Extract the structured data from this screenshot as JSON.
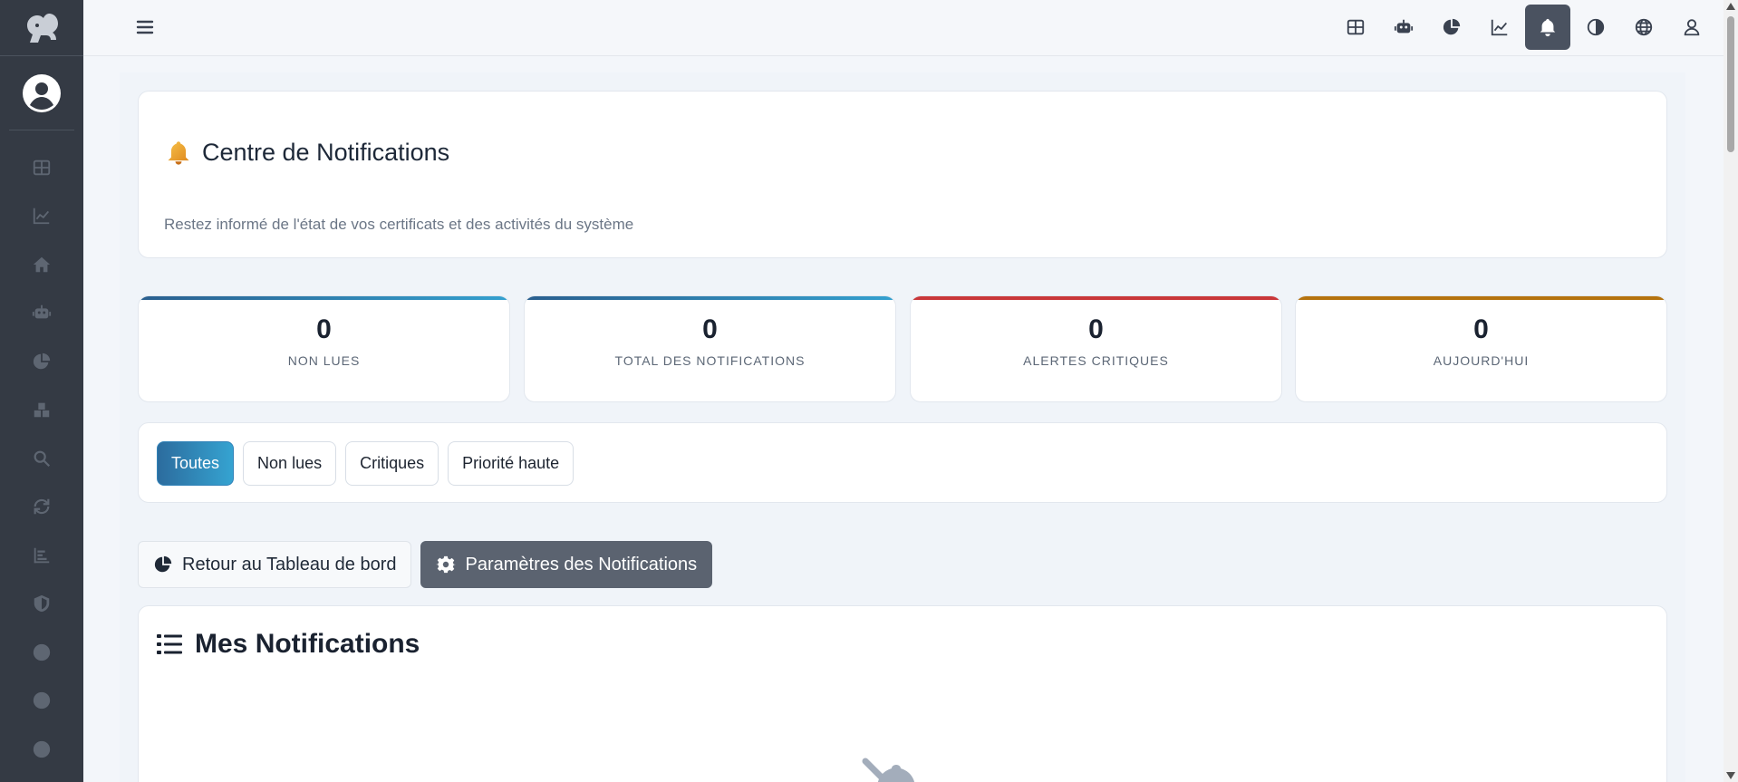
{
  "header": {
    "title": "Centre de Notifications",
    "subtitle": "Restez informé de l'état de vos certificats et des activités du système"
  },
  "stats": [
    {
      "value": "0",
      "label": "NON LUES",
      "color": "#2d75a8"
    },
    {
      "value": "0",
      "label": "TOTAL DES NOTIFICATIONS",
      "color": "#2d75a8"
    },
    {
      "value": "0",
      "label": "ALERTES CRITIQUES",
      "color": "#c9373a"
    },
    {
      "value": "0",
      "label": "AUJOURD'HUI",
      "color": "#b5730f"
    }
  ],
  "filters": [
    {
      "label": "Toutes",
      "active": true
    },
    {
      "label": "Non lues",
      "active": false
    },
    {
      "label": "Critiques",
      "active": false
    },
    {
      "label": "Priorité haute",
      "active": false
    }
  ],
  "actions": {
    "back": "Retour au Tableau de bord",
    "settings": "Paramètres des Notifications"
  },
  "notifications": {
    "title": "Mes Notifications"
  },
  "colors": {
    "sidebar": "#343a44",
    "accent": "#2c7fb8",
    "active_nav": "#4a5260"
  },
  "icons": {
    "sidebar": [
      "grid-icon",
      "chart-line-icon",
      "home-icon",
      "robot-icon",
      "pie-chart-icon",
      "boxes-icon",
      "search-icon",
      "sync-icon",
      "bar-chart-icon",
      "shield-icon",
      "circle-icon",
      "circle-icon",
      "circle-icon"
    ],
    "topbar": [
      "grid-icon",
      "robot-icon",
      "pie-chart-icon",
      "chart-line-icon",
      "bell-icon",
      "contrast-icon",
      "globe-icon",
      "user-icon"
    ]
  }
}
